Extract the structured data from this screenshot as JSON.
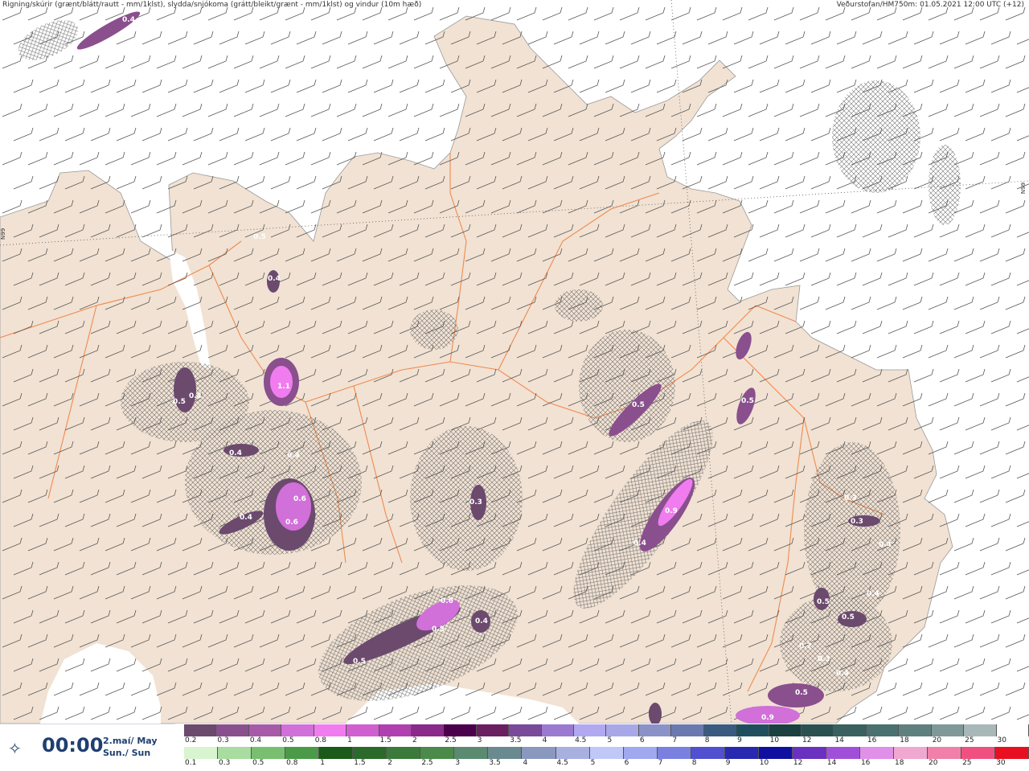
{
  "header": {
    "title": "Rigning/skúrir (grænt/blátt/rautt - mm/1klst), slydda/snjókoma (grátt/bleikt/grænt - mm/1klst) og vindur (10m hæð)",
    "source": "Veðurstofan/HM750m: 01.05.2021 12:00 UTC (+12)"
  },
  "map": {
    "graticule_label": "N99",
    "colors": {
      "land": "#f1e2d3",
      "sea": "#ffffff",
      "roads": "#f08a50",
      "precip_low": "#6b3a7a",
      "precip_mid": "#b050c0",
      "precip_high": "#f070f0"
    },
    "precip_labels": [
      {
        "id": "a",
        "text": "0.4"
      },
      {
        "id": "b",
        "text": "0.5"
      },
      {
        "id": "c",
        "text": "0.4"
      },
      {
        "id": "d",
        "text": "1.1"
      },
      {
        "id": "e",
        "text": "0.5"
      },
      {
        "id": "f",
        "text": "0.4"
      },
      {
        "id": "g",
        "text": "0.4"
      },
      {
        "id": "h",
        "text": "0.4"
      },
      {
        "id": "i",
        "text": "0.6"
      },
      {
        "id": "j",
        "text": "0.6"
      },
      {
        "id": "k",
        "text": "0.4"
      },
      {
        "id": "l",
        "text": "0.3"
      },
      {
        "id": "m",
        "text": "0.5"
      },
      {
        "id": "n",
        "text": "0.9"
      },
      {
        "id": "o",
        "text": "0.4"
      },
      {
        "id": "p",
        "text": "0.5"
      },
      {
        "id": "q",
        "text": "0.6"
      },
      {
        "id": "r",
        "text": "0.5"
      },
      {
        "id": "s",
        "text": "0.4"
      },
      {
        "id": "t",
        "text": "0.5"
      },
      {
        "id": "u",
        "text": "0.3"
      },
      {
        "id": "v",
        "text": "0.4"
      },
      {
        "id": "w",
        "text": "0.5"
      },
      {
        "id": "x",
        "text": "0.4"
      },
      {
        "id": "y",
        "text": "0.5"
      },
      {
        "id": "z",
        "text": "0.3"
      },
      {
        "id": "aa",
        "text": "0.4"
      },
      {
        "id": "ab",
        "text": "0.5"
      },
      {
        "id": "ac",
        "text": "0.9"
      },
      {
        "id": "ad",
        "text": "0.7"
      },
      {
        "id": "ae",
        "text": "0.3"
      }
    ]
  },
  "time": {
    "clock_icon": "clock-arrows-icon",
    "value": "00:00",
    "date_is": "2.maí/ May",
    "day": "Sun./ Sun"
  },
  "legend": {
    "snow": {
      "labels": [
        "0.2",
        "0.3",
        "0.4",
        "0.5",
        "0.8",
        "1",
        "1.5",
        "2",
        "2.5",
        "3",
        "3.5",
        "4",
        "4.5",
        "5",
        "6",
        "7",
        "8",
        "9",
        "10",
        "12",
        "14",
        "16",
        "18",
        "20",
        "25",
        "30"
      ],
      "colors": [
        "#6b4a6e",
        "#8a4f8d",
        "#a65aa8",
        "#d070d8",
        "#f07cf0",
        "#d060d0",
        "#b040b0",
        "#8a2a8a",
        "#4a004a",
        "#6a2060",
        "#7a4a9a",
        "#9a7ad0",
        "#b0a8f0",
        "#a8a8e8",
        "#8a92c8",
        "#6a7ab0",
        "#3a5a80",
        "#1f4f5f",
        "#1a4040",
        "#2a5050",
        "#3a6060",
        "#4a7070",
        "#608080",
        "#809898",
        "#a8b8b8",
        "#ffffff"
      ]
    },
    "rain": {
      "labels": [
        "0.1",
        "0.3",
        "0.5",
        "0.8",
        "1",
        "1.5",
        "2",
        "2.5",
        "3",
        "3.5",
        "4",
        "4.5",
        "5",
        "6",
        "7",
        "8",
        "9",
        "10",
        "12",
        "14",
        "16",
        "18",
        "20",
        "25",
        "30"
      ],
      "colors": [
        "#d8f5d0",
        "#a8dca0",
        "#78c070",
        "#4a9a48",
        "#1a5a1a",
        "#2a6a2a",
        "#3a7a3a",
        "#4a8a4a",
        "#5a8a70",
        "#6a8a90",
        "#8a98c0",
        "#a8b0e0",
        "#c0c8f8",
        "#a0a8f0",
        "#7a80e0",
        "#5050d0",
        "#2828b0",
        "#1010a0",
        "#6a30c0",
        "#a050d8",
        "#e090e8",
        "#f0a8d0",
        "#f080a8",
        "#f05080",
        "#e81020"
      ]
    }
  }
}
